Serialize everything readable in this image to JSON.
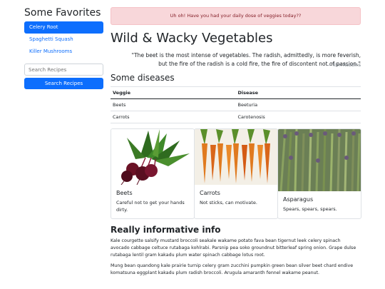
{
  "sidebar": {
    "title": "Some Favorites",
    "items": [
      {
        "label": "Celery Root",
        "active": true
      },
      {
        "label": "Spaghetti Squash",
        "active": false
      },
      {
        "label": "Killer Mushrooms",
        "active": false
      }
    ],
    "search_placeholder": "Search Recipes",
    "search_button": "Search Recipes"
  },
  "alert": {
    "text": "Uh oh! Have you had your daily dose of veggies today??"
  },
  "main": {
    "title": "Wild & Wacky Vegetables",
    "quote": "\"The beet is the most intense of vegetables. The radish, admittedly, is more feverish, but the fire of the radish is a cold fire, the fire of discontent not of passion.\"",
    "quote_author": "— Tom Robbins"
  },
  "diseases": {
    "heading": "Some diseases",
    "columns": [
      "Veggie",
      "Disease"
    ],
    "rows": [
      [
        "Beets",
        "Beeturia"
      ],
      [
        "Carrots",
        "Carotenosis"
      ]
    ]
  },
  "cards": [
    {
      "title": "Beets",
      "text": "Careful not to get your hands dirty.",
      "image": "beets-photo"
    },
    {
      "title": "Carrots",
      "text": "Not sticks, can motivate.",
      "image": "carrots-photo"
    },
    {
      "title": "Asparagus",
      "text": "Spears, spears, spears.",
      "image": "asparagus-photo"
    }
  ],
  "info": {
    "heading": "Really informative info",
    "paragraphs": [
      "Kale courgette salsify mustard broccoli seakale wakame potato fava bean tigernut leek celery spinach avocado cabbage celtuce rutabaga kohlrabi. Parsnip pea soko groundnut bitterleaf spring onion. Grape dulse rutabaga lentil gram kakadu plum water spinach cabbage lotus root.",
      "Mung bean quandong kale prairie turnip celery gram zucchini pumpkin green bean silver beet chard endive komatsuna eggplant kakadu plum radish broccoli. Arugula amaranth fennel wakame peanut."
    ]
  },
  "colors": {
    "primary": "#0d6efd",
    "alert_bg": "#f8d7da",
    "alert_text": "#842029"
  }
}
